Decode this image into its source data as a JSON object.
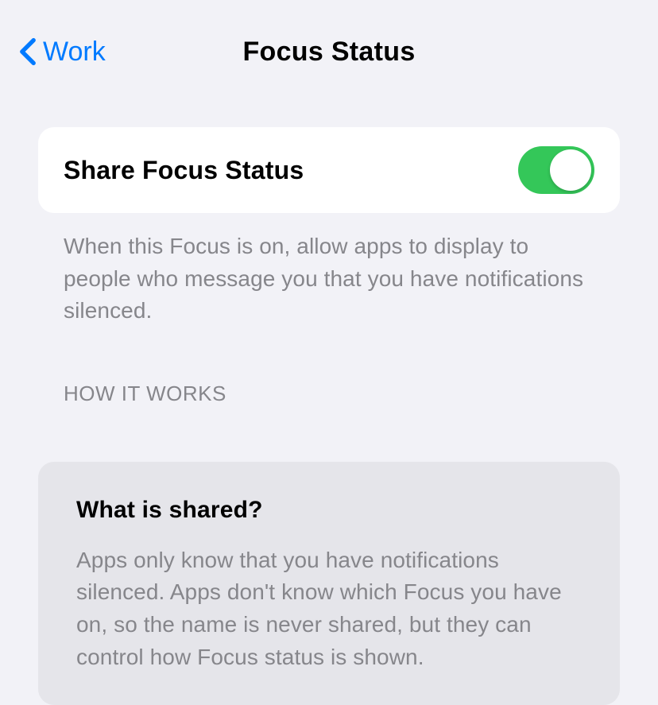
{
  "nav": {
    "back_label": "Work",
    "title": "Focus Status"
  },
  "share_toggle": {
    "label": "Share Focus Status",
    "enabled": true,
    "footer": "When this Focus is on, allow apps to display to people who message you that you have notifications silenced."
  },
  "how_it_works": {
    "header": "HOW IT WORKS",
    "card": {
      "title": "What is shared?",
      "body": "Apps only know that you have notifications silenced. Apps don't know which Focus you have on, so the name is never shared, but they can control how Focus status is shown."
    }
  }
}
